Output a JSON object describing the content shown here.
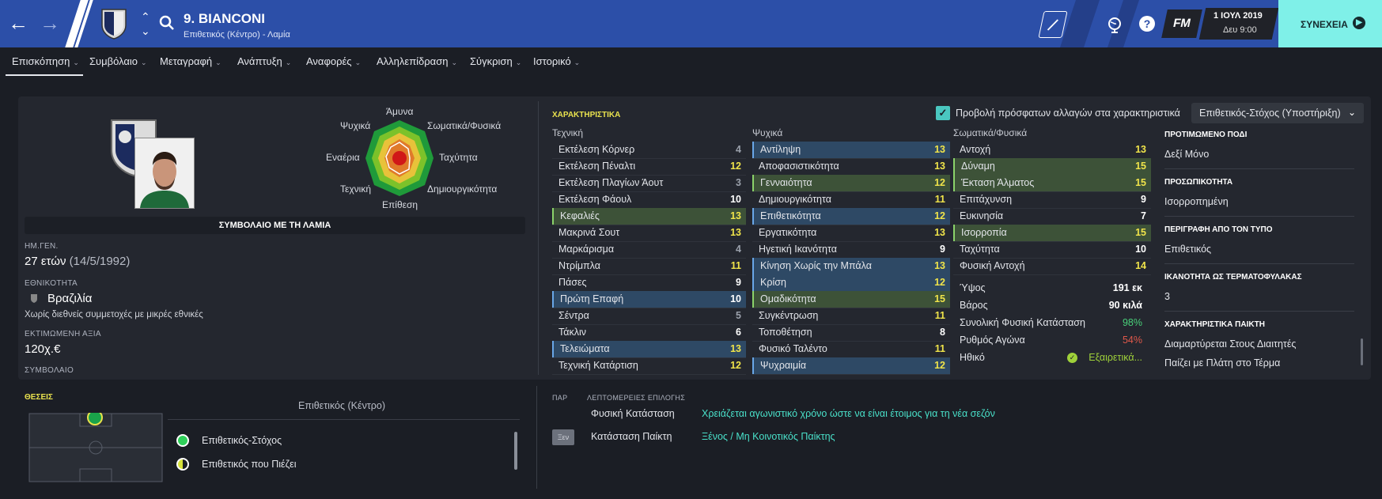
{
  "header": {
    "name": "9. BIANCONI",
    "subtitle": "Επιθετικός (Κέντρο) - Λαμία",
    "date": "1 ΙΟΥΛ 2019",
    "time": "Δευ 9:00",
    "continue": "ΣΥΝΕΧΕΙΑ",
    "fm": "FM",
    "help": "?"
  },
  "tabs": [
    "Επισκόπηση",
    "Συμβόλαιο",
    "Μεταγραφή",
    "Ανάπτυξη",
    "Αναφορές",
    "Αλληλεπίδραση",
    "Σύγκριση",
    "Ιστορικό"
  ],
  "profile": {
    "radar_labels": {
      "top": "Άμυνα",
      "tr": "Σωματικά/Φυσικά",
      "r": "Ταχύτητα",
      "br": "Δημιουργικότητα",
      "b": "Επίθεση",
      "bl": "Τεχνική",
      "l": "Εναέρια",
      "tl": "Ψυχικά"
    },
    "contract_title": "ΣΥΜΒΟΛΑΙΟ ΜΕ ΤΗ ΛΑΜΙΑ",
    "dob_label": "ΗΜ.ΓΕΝ.",
    "age": "27 ετών",
    "dob": "(14/5/1992)",
    "nationality_label": "ΕΘΝΙΚΟΤΗΤΑ",
    "nationality": "Βραζιλία",
    "intl": "Χωρίς διεθνείς συμμετοχές με μικρές εθνικές",
    "value_label": "ΕΚΤΙΜΩΜΕΝΗ ΑΞΙΑ",
    "value": "120χ.€",
    "contract_label": "ΣΥΜΒΟΛΑΙΟ"
  },
  "attributes": {
    "title": "ΧΑΡΑΚΤΗΡΙΣΤΙΚΑ",
    "show_changes": "Προβολή πρόσφατων αλλαγών στα χαρακτηριστικά",
    "role": "Επιθετικός-Στόχος (Υποστήριξη)",
    "technical_head": "Τεχνική",
    "mental_head": "Ψυχικά",
    "physical_head": "Σωματικά/Φυσικά",
    "technical": [
      {
        "n": "Εκτέλεση Κόρνερ",
        "v": "4",
        "c": "grey",
        "h": ""
      },
      {
        "n": "Εκτέλεση Πέναλτι",
        "v": "12",
        "c": "yellow",
        "h": ""
      },
      {
        "n": "Εκτέλεση Πλαγίων Άουτ",
        "v": "3",
        "c": "grey",
        "h": ""
      },
      {
        "n": "Εκτέλεση Φάουλ",
        "v": "10",
        "c": "white",
        "h": ""
      },
      {
        "n": "Κεφαλιές",
        "v": "13",
        "c": "yellow",
        "h": "green"
      },
      {
        "n": "Μακρινά Σουτ",
        "v": "13",
        "c": "yellow",
        "h": ""
      },
      {
        "n": "Μαρκάρισμα",
        "v": "4",
        "c": "grey",
        "h": ""
      },
      {
        "n": "Ντρίμπλα",
        "v": "11",
        "c": "yellow",
        "h": ""
      },
      {
        "n": "Πάσες",
        "v": "9",
        "c": "white",
        "h": ""
      },
      {
        "n": "Πρώτη Επαφή",
        "v": "10",
        "c": "white",
        "h": "blue"
      },
      {
        "n": "Σέντρα",
        "v": "5",
        "c": "grey",
        "h": ""
      },
      {
        "n": "Τάκλιν",
        "v": "6",
        "c": "white",
        "h": ""
      },
      {
        "n": "Τελειώματα",
        "v": "13",
        "c": "yellow",
        "h": "blue"
      },
      {
        "n": "Τεχνική Κατάρτιση",
        "v": "12",
        "c": "yellow",
        "h": ""
      }
    ],
    "mental": [
      {
        "n": "Αντίληψη",
        "v": "13",
        "c": "yellow",
        "h": "blue"
      },
      {
        "n": "Αποφασιστικότητα",
        "v": "13",
        "c": "yellow",
        "h": ""
      },
      {
        "n": "Γενναιότητα",
        "v": "12",
        "c": "yellow",
        "h": "green"
      },
      {
        "n": "Δημιουργικότητα",
        "v": "11",
        "c": "yellow",
        "h": ""
      },
      {
        "n": "Επιθετικότητα",
        "v": "12",
        "c": "yellow",
        "h": "blue"
      },
      {
        "n": "Εργατικότητα",
        "v": "13",
        "c": "yellow",
        "h": ""
      },
      {
        "n": "Ηγετική Ικανότητα",
        "v": "9",
        "c": "white",
        "h": ""
      },
      {
        "n": "Κίνηση Χωρίς την Μπάλα",
        "v": "13",
        "c": "yellow",
        "h": "blue"
      },
      {
        "n": "Κρίση",
        "v": "12",
        "c": "yellow",
        "h": "blue"
      },
      {
        "n": "Ομαδικότητα",
        "v": "15",
        "c": "yellow",
        "h": "green"
      },
      {
        "n": "Συγκέντρωση",
        "v": "11",
        "c": "yellow",
        "h": ""
      },
      {
        "n": "Τοποθέτηση",
        "v": "8",
        "c": "white",
        "h": ""
      },
      {
        "n": "Φυσικό Ταλέντο",
        "v": "11",
        "c": "yellow",
        "h": ""
      },
      {
        "n": "Ψυχραιμία",
        "v": "12",
        "c": "yellow",
        "h": "blue"
      }
    ],
    "physical": [
      {
        "n": "Αντοχή",
        "v": "13",
        "c": "yellow",
        "h": ""
      },
      {
        "n": "Δύναμη",
        "v": "15",
        "c": "yellow",
        "h": "green"
      },
      {
        "n": "Έκταση Άλματος",
        "v": "15",
        "c": "yellow",
        "h": "green"
      },
      {
        "n": "Επιτάχυνση",
        "v": "9",
        "c": "white",
        "h": ""
      },
      {
        "n": "Ευκινησία",
        "v": "7",
        "c": "white",
        "h": ""
      },
      {
        "n": "Ισορροπία",
        "v": "15",
        "c": "yellow",
        "h": "green"
      },
      {
        "n": "Ταχύτητα",
        "v": "10",
        "c": "white",
        "h": ""
      },
      {
        "n": "Φυσική Αντοχή",
        "v": "14",
        "c": "yellow",
        "h": ""
      }
    ],
    "extra": [
      {
        "n": "Ύψος",
        "v": "191 εκ",
        "c": "#ffffff"
      },
      {
        "n": "Βάρος",
        "v": "90 κιλά",
        "c": "#ffffff"
      },
      {
        "n": "Συνολική Φυσική Κατάσταση",
        "v": "98%",
        "c": "#49d17a"
      },
      {
        "n": "Ρυθμός Αγώνα",
        "v": "54%",
        "c": "#e0584a"
      },
      {
        "n": "Ηθικό",
        "v": "Εξαιρετικά...",
        "c": "#9fd13a"
      }
    ]
  },
  "info": [
    {
      "t": "ΠΡΟΤΙΜΩΜΕΝΟ ΠΟΔΙ",
      "v": "Δεξί Μόνο"
    },
    {
      "t": "ΠΡΟΣΩΠΙΚΟΤΗΤΑ",
      "v": "Ισορροπημένη"
    },
    {
      "t": "ΠΕΡΙΓΡΑΦΗ ΑΠΟ ΤΟΝ ΤΥΠΟ",
      "v": "Επιθετικός"
    },
    {
      "t": "ΙΚΑΝΟΤΗΤΑ ΩΣ ΤΕΡΜΑΤΟΦΥΛΑΚΑΣ",
      "v": "3"
    },
    {
      "t": "ΧΑΡΑΚΤΗΡΙΣΤΙΚΑ ΠΑΙΚΤΗ",
      "v": "Διαμαρτύρεται Στους Διαιτητές",
      "v2": "Παίζει με Πλάτη στο Τέρμα"
    }
  ],
  "positions": {
    "title": "ΘΕΣΕΙΣ",
    "main": "Επιθετικός (Κέντρο)",
    "roles": [
      {
        "n": "Επιθετικός-Στόχος",
        "fill": "full"
      },
      {
        "n": "Επιθετικός που Πιέζει",
        "fill": "half"
      }
    ]
  },
  "selection": {
    "col1": "ΠΑΡ",
    "col2": "ΛΕΠΤΟΜΕΡΕΙΕΣ ΕΠΙΛΟΓΗΣ",
    "rows": [
      {
        "badge": "",
        "label": "Φυσική Κατάσταση",
        "value": "Χρειάζεται αγωνιστικό χρόνο ώστε να είναι έτοιμος για τη νέα σεζόν"
      },
      {
        "badge": "Ξεν",
        "label": "Κατάσταση Παίκτη",
        "value": "Ξένος / Μη Κοινοτικός Παίκτης"
      }
    ]
  },
  "colors": {
    "accent": "#2c4fa8",
    "continue": "#7ff0e8",
    "highlight_yellow": "#e9e24e",
    "teal_text": "#49e0c9"
  }
}
